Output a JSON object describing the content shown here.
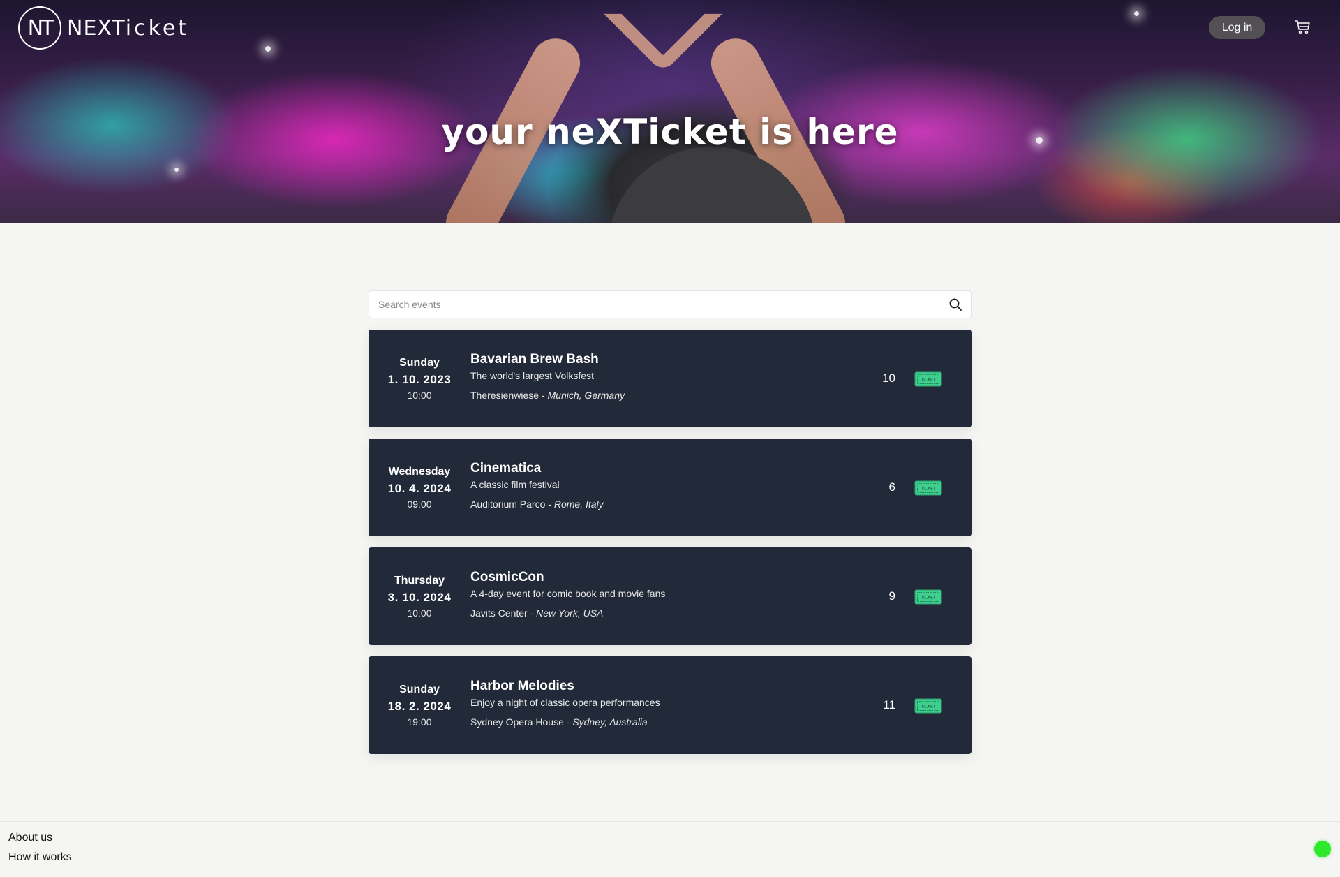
{
  "brand": {
    "logo_initials": "NT",
    "logo_text_bold": "NEXT",
    "logo_text_rest": "icket"
  },
  "header": {
    "login_label": "Log in",
    "cart_icon": "cart-icon"
  },
  "hero": {
    "tagline": "your neXTicket is here"
  },
  "search": {
    "placeholder": "Search events",
    "value": "",
    "icon": "search-icon"
  },
  "events": [
    {
      "day_of_week": "Sunday",
      "date": "1. 10. 2023",
      "time": "10:00",
      "name": "Bavarian Brew Bash",
      "description": "The world's largest Volksfest",
      "venue": "Theresienwiese",
      "location": "Munich, Germany",
      "tickets": "10"
    },
    {
      "day_of_week": "Wednesday",
      "date": "10. 4. 2024",
      "time": "09:00",
      "name": "Cinematica",
      "description": "A classic film festival",
      "venue": "Auditorium Parco",
      "location": "Rome, Italy",
      "tickets": "6"
    },
    {
      "day_of_week": "Thursday",
      "date": "3. 10. 2024",
      "time": "10:00",
      "name": "CosmicCon",
      "description": "A 4-day event for comic book and movie fans",
      "venue": "Javits Center",
      "location": "New York, USA",
      "tickets": "9"
    },
    {
      "day_of_week": "Sunday",
      "date": "18. 2. 2024",
      "time": "19:00",
      "name": "Harbor Melodies",
      "description": "Enjoy a night of classic opera performances",
      "venue": "Sydney Opera House",
      "location": "Sydney, Australia",
      "tickets": "11"
    }
  ],
  "ticket_badge_label": "TICKET",
  "footer": {
    "links": [
      "About us",
      "How it works"
    ]
  },
  "colors": {
    "card_bg": "#222a39",
    "ticket_green": "#3ecf8e",
    "status_dot": "#2ee82a",
    "page_bg": "#f5f5f3"
  }
}
